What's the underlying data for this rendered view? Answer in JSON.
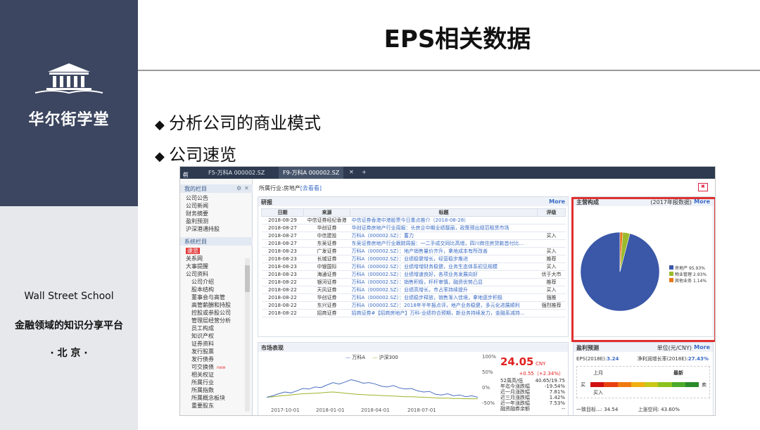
{
  "sidebar": {
    "brand_name": "华尔街学堂",
    "school_en": "Wall Street School",
    "slogan": "金融领域的知识分享平台",
    "city": "· 北 京 ·",
    "colors": {
      "brand_bg": "#3c4660",
      "panel_bg": "#e6e8ec"
    }
  },
  "slide": {
    "title": "EPS相关数据",
    "bullets": [
      "分析公司的商业模式",
      "公司速览"
    ]
  },
  "screenshot": {
    "tabs": {
      "home": "首页",
      "tab1": "F5-万科A 000002.SZ",
      "tab2": "F9-万科A 000002.SZ",
      "close": "✕",
      "add": "+"
    },
    "industry": {
      "label": "所属行业:房地产",
      "link": "[去看看]"
    },
    "nav": {
      "section1": "我的栏目",
      "section1_items": [
        "公司公告",
        "公司新闻",
        "财务摘要",
        "盈利预测",
        "沪深港通持股"
      ],
      "section2": "系统栏目",
      "section2_items": [
        "速览",
        "关系网",
        "大事提醒",
        "公司资料",
        "公司介绍",
        "股本结构",
        "董事会与高管",
        "高管薪酬和持股",
        "控股或参股公司",
        "管理层经营分析",
        "员工构成",
        "知识产权",
        "证券资料",
        "发行股票",
        "发行债券",
        "可交换债",
        "相关权证",
        "所属行业",
        "所属指数",
        "所属概念板块",
        "重要股东"
      ],
      "new_badge": "new"
    },
    "research": {
      "title": "研报",
      "more": "More",
      "headers": [
        "日期",
        "来源",
        "标题",
        "评级"
      ],
      "rows": [
        [
          "2018-08-29",
          "中信证券经纪香港",
          "中信证券香港中港股票今日重点推介（2018-08-28）",
          ""
        ],
        [
          "2018-08-27",
          "华创证券",
          "华创证券房地产行业周报：头房企中期业绩靓丽，政策预出规范租赁市场",
          ""
        ],
        [
          "2018-08-27",
          "中信建投",
          "万科A（000002.SZ）：蓄力",
          "买入"
        ],
        [
          "2018-08-27",
          "东吴证券",
          "东吴证券房地产行业跟踪周报：一二手成交同比高增，四川商住房贷款首付比...",
          ""
        ],
        [
          "2018-08-23",
          "广发证券",
          "万科A（000002.SZ）：地产销售量价齐升，拿地成本有所改善",
          "买入"
        ],
        [
          "2018-08-23",
          "长城证券",
          "万科A（000002.SZ）：业绩稳健增长，经营稳步推进",
          "推荐"
        ],
        [
          "2018-08-23",
          "中银国际",
          "万科A（000002.SZ）：业绩增增财务稳健，业务生态体系初见规模",
          "买入"
        ],
        [
          "2018-08-23",
          "海通证券",
          "万科A（000002.SZ）：业绩增速良好，各项业务发展向好",
          "优于大市"
        ],
        [
          "2018-08-22",
          "银河证券",
          "万科A（000002.SZ）：销售积极，杆杆审慎，融资优势凸显",
          "推荐"
        ],
        [
          "2018-08-22",
          "天风证券",
          "万科A（000002.SZ）：业绩高增长，市占率持续提升",
          "买入"
        ],
        [
          "2018-08-22",
          "华创证券",
          "万科A（000002.SZ）：业绩稳步释放，销售渐入佳境，拿地逐步积极",
          "强推"
        ],
        [
          "2018-08-22",
          "东兴证券",
          "万科A（000002.SZ）：2018年半年报点评，地产业务稳健，多元化进展顺利",
          "强烈推荐"
        ],
        [
          "2018-08-22",
          "招商证券",
          "招商证券#【招商房地产】万科-业绩符合预期，新业务持续发力，金融系减持...",
          ""
        ]
      ]
    },
    "composition": {
      "title": "主营构成",
      "note": "(2017年报数据)",
      "more": "More",
      "legend": [
        {
          "name": "房地产",
          "pct": "95.93%",
          "color": "#3a57a8"
        },
        {
          "name": "物业管理",
          "pct": "2.93%",
          "color": "#9bbb2c"
        },
        {
          "name": "其他业务",
          "pct": "1.14%",
          "color": "#e8771a"
        }
      ],
      "highlight_color": "#e03030"
    },
    "market": {
      "title": "市场表现",
      "legend": [
        "万科A",
        "沪深300"
      ],
      "y_ticks": [
        "100%",
        "50%",
        "0%",
        "-50%"
      ],
      "x_ticks": [
        "2017-10-01",
        "2018-01-01",
        "2018-04-01",
        "2018-07-01"
      ],
      "price": "24.05",
      "currency": "CNY",
      "change": "+0.55（+2.34%）",
      "stats": [
        [
          "52周高/低",
          "40.65/19.75"
        ],
        [
          "年迄今涨跌幅",
          "-19.54%"
        ],
        [
          "近一月涨跌幅",
          "7.81%"
        ],
        [
          "近三月涨跌幅",
          "1.42%"
        ],
        [
          "近一年涨跌幅",
          "7.53%"
        ],
        [
          "融资融券余额",
          "--"
        ]
      ],
      "colors": {
        "stock": "#4a6fc1",
        "index": "#9bb52a"
      }
    },
    "forecast": {
      "title": "盈利预测",
      "unit": "单位(元/CNY)",
      "more": "More",
      "eps_label": "EPS(2018E):",
      "eps_value": "3.24",
      "growth_label": "净利润增长率(2018E):",
      "growth_value": "27.43%",
      "last_month": "上月",
      "latest": "最新",
      "buy": "买",
      "sell": "卖",
      "buy_in": "买入",
      "target_label": "一致目标...:",
      "target_value": "34.54",
      "upside_label": "上涨空间:",
      "upside_value": "43.60%"
    }
  }
}
